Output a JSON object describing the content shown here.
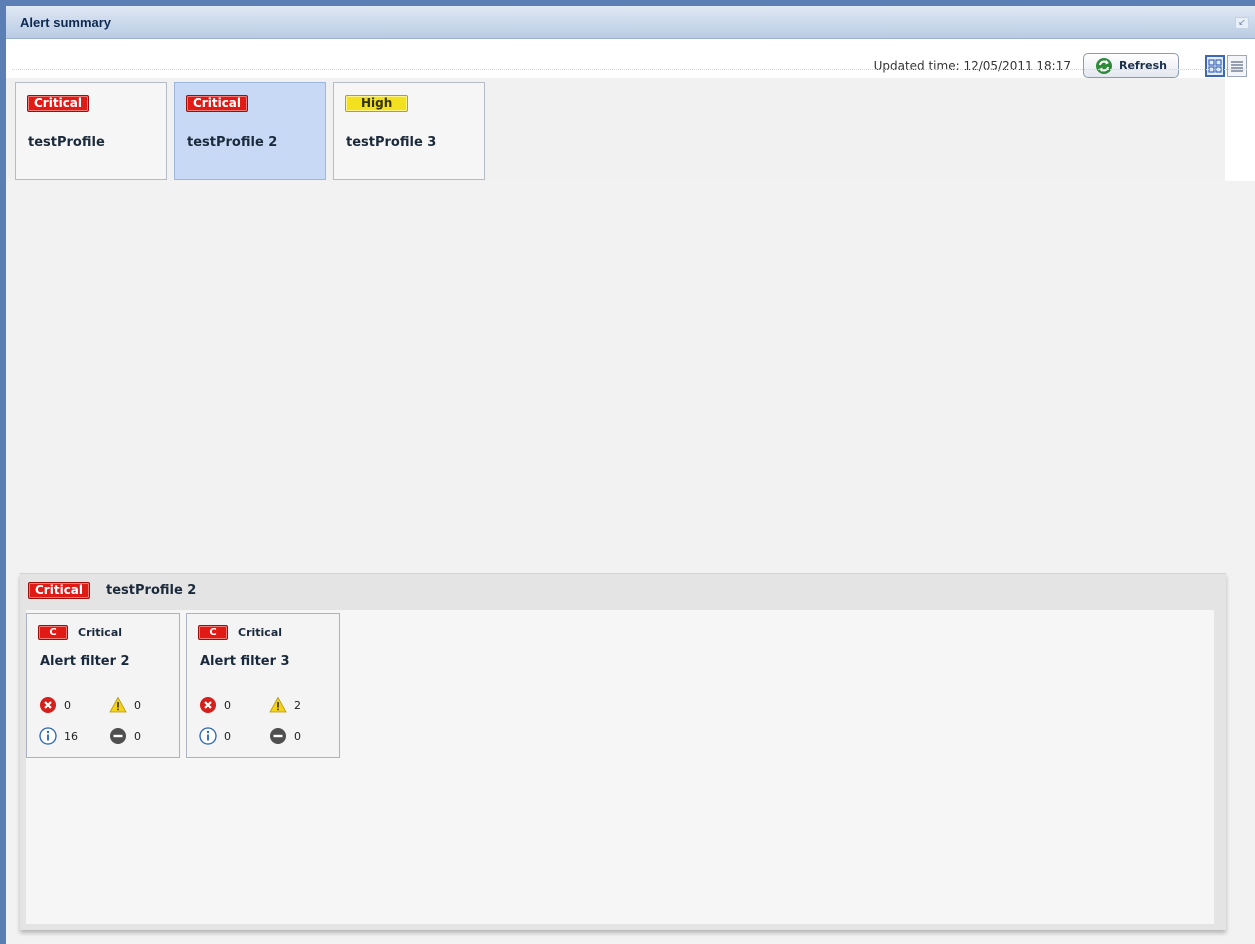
{
  "window": {
    "title": "Alert summary"
  },
  "toolbar": {
    "updated_time": "Updated time: 12/05/2011 18:17",
    "refresh_label": "Refresh"
  },
  "profiles": [
    {
      "severity": "Critical",
      "name": "testProfile",
      "selected": false
    },
    {
      "severity": "Critical",
      "name": "testProfile 2",
      "selected": true
    },
    {
      "severity": "High",
      "name": "testProfile 3",
      "selected": false
    }
  ],
  "detail": {
    "severity": "Critical",
    "title": "testProfile 2",
    "filters": [
      {
        "chip": "C",
        "severity": "Critical",
        "name": "Alert filter 2",
        "counts": {
          "error": "0",
          "warning": "0",
          "info": "16",
          "unknown": "0"
        }
      },
      {
        "chip": "C",
        "severity": "Critical",
        "name": "Alert filter 3",
        "counts": {
          "error": "0",
          "warning": "2",
          "info": "0",
          "unknown": "0"
        }
      }
    ]
  },
  "colors": {
    "critical": "#e01b16",
    "high": "#f3e01f",
    "selected": "#c7d9f5",
    "frame": "#5b7fb5"
  },
  "icons": {
    "refresh": "refresh-icon",
    "tile_view": "tile-view-icon",
    "list_view": "list-view-icon",
    "error": "error-icon",
    "warning": "warning-icon",
    "info": "info-icon",
    "unknown": "unknown-icon"
  }
}
